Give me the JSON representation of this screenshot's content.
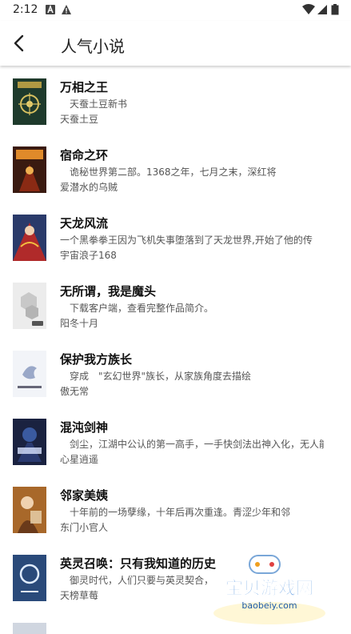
{
  "status_bar": {
    "time": "2:12"
  },
  "header": {
    "title": "人气小说"
  },
  "books": [
    {
      "title": "万相之王",
      "desc": "　天蚕土豆新书",
      "author": "天蚕土豆"
    },
    {
      "title": "宿命之环",
      "desc": "　诡秘世界第二部。1368之年，七月之末，深红将",
      "author": "爱潜水的乌贼"
    },
    {
      "title": "天龙风流",
      "desc": "一个黑拳拳王因为飞机失事堕落到了天龙世界,开始了他的传",
      "author": "宇宙浪子168"
    },
    {
      "title": "无所谓，我是魔头",
      "desc": "　下载客户端，查看完整作品简介。",
      "author": "阳冬十月"
    },
    {
      "title": "保护我方族长",
      "desc": "　穿成　\"玄幻世界\"族长，从家族角度去描绘",
      "author": "傲无常"
    },
    {
      "title": "混沌剑神",
      "desc": "　剑尘，江湖中公认的第一高手，一手快剑法出神入化，无人能",
      "author": "心星逍遥"
    },
    {
      "title": "邻家美姨",
      "desc": "　十年前的一场孽缘，十年后再次重逢。青涩少年和邻",
      "author": "东门小官人"
    },
    {
      "title": "英灵召唤：只有我知道的历史",
      "desc": "　御灵时代，人们只要与英灵契合，",
      "author": "天榜草莓"
    }
  ],
  "watermark": {
    "text": "宝贝游戏网",
    "url": "baobeiy.com"
  }
}
